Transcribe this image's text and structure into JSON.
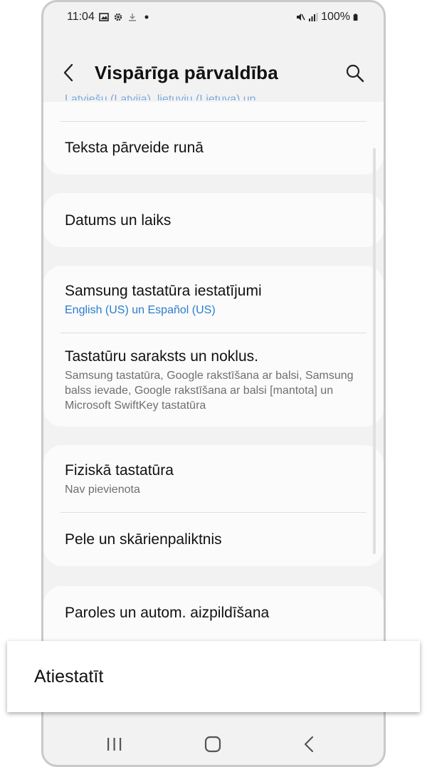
{
  "status": {
    "time": "11:04",
    "battery": "100%"
  },
  "header": {
    "title": "Vispārīga pārvaldība"
  },
  "sections": [
    {
      "partial": "Latviešu (Latvija), lietuvių (Lietuva) un ...",
      "items": [
        {
          "title": "Teksta pārveide runā"
        }
      ]
    },
    {
      "items": [
        {
          "title": "Datums un laiks"
        }
      ]
    },
    {
      "items": [
        {
          "title": "Samsung tastatūra iestatījumi",
          "sub": "English (US) un Español (US)"
        },
        {
          "title": "Tastatūru saraksts un noklus.",
          "sub": "Samsung tastatūra, Google rakstīšana ar balsi, Samsung balss ievade, Google rakstīšana ar balsi [mantota] un Microsoft SwiftKey tastatūra"
        }
      ]
    },
    {
      "items": [
        {
          "title": "Fiziskā tastatūra",
          "sub": "Nav pievienota"
        },
        {
          "title": "Pele un skārienpaliktnis"
        }
      ]
    },
    {
      "items": [
        {
          "title": "Paroles un autom. aizpildīšana"
        }
      ]
    }
  ],
  "overlay": {
    "label": "Atiestatīt"
  },
  "colors": {
    "accent": "#2b7cd0",
    "background": "#f2f2f2",
    "card": "#fbfbfb"
  },
  "icons": [
    "back-arrow-icon",
    "search-icon",
    "recent-apps-icon",
    "home-icon",
    "back-icon"
  ]
}
